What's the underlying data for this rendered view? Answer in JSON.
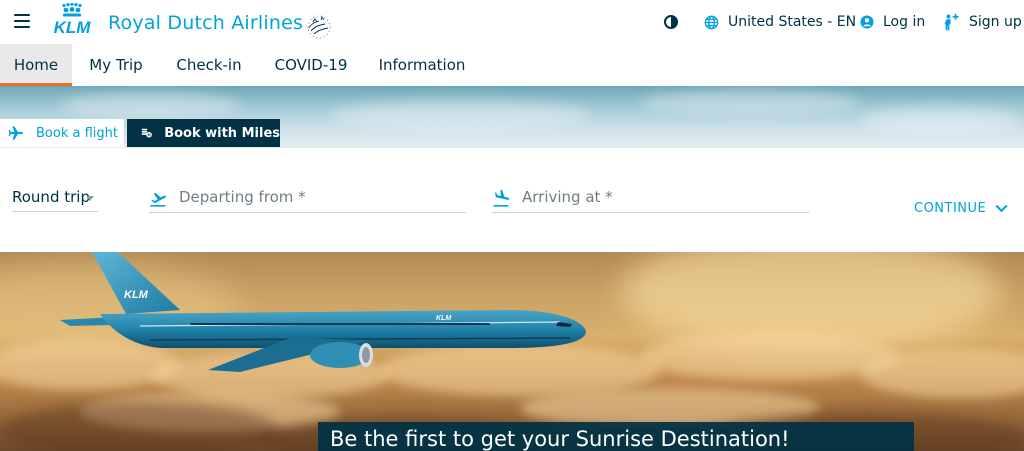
{
  "header": {
    "brand_logo_text": "KLM",
    "brand_name": "Royal Dutch Airlines",
    "language_label": "United States - EN",
    "login_label": "Log in",
    "signup_label": "Sign up"
  },
  "nav": {
    "tabs": [
      {
        "label": "Home",
        "active": true
      },
      {
        "label": "My Trip",
        "active": false
      },
      {
        "label": "Check-in",
        "active": false
      },
      {
        "label": "COVID-19",
        "active": false
      },
      {
        "label": "Information",
        "active": false
      }
    ]
  },
  "booking": {
    "tabs": [
      {
        "label": "Book a flight",
        "active": true
      },
      {
        "label": "Book with Miles",
        "active": false
      }
    ],
    "trip_type": "Round trip",
    "departing_placeholder": "Departing from *",
    "arriving_placeholder": "Arriving at *",
    "continue_label": "CONTINUE"
  },
  "hero": {
    "aircraft_tail_text": "KLM",
    "aircraft_fuselage_text": "KLM",
    "promo_text": "Be the first to get your Sunrise Destination!"
  },
  "colors": {
    "brand_blue": "#00a1de",
    "navy": "#003145",
    "active_tab_underline": "#e37222"
  },
  "icons": {
    "menu": "hamburger-menu-icon",
    "logo": "klm-crown-logo",
    "seal": "royal-seal-icon",
    "contrast": "contrast-icon",
    "language": "globe-icon",
    "login": "user-circle-icon",
    "signup": "person-plus-icon",
    "book_flight": "airplane-icon",
    "book_miles": "miles-coins-icon",
    "departing": "takeoff-icon",
    "arriving": "landing-icon",
    "continue": "chevron-down-icon"
  }
}
